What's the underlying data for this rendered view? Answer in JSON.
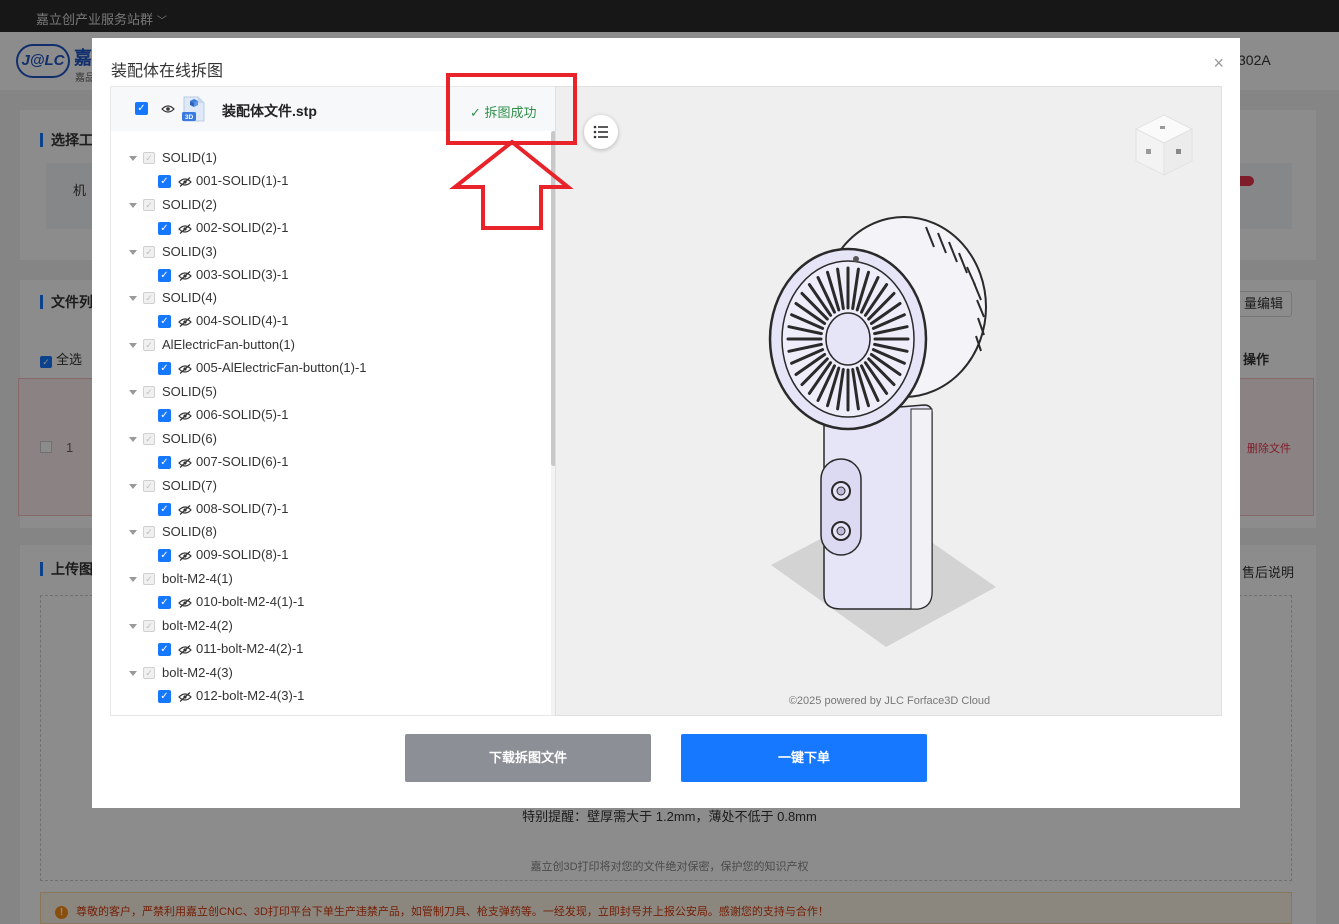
{
  "topbar": {
    "site_group": "嘉立创产业服务站群"
  },
  "header": {
    "logo": "J@LC",
    "logo_text": "嘉",
    "logo_sub": "嘉品",
    "user_code": "302A"
  },
  "background": {
    "section_process": "选择工",
    "option_label": "机",
    "section_files": "文件列",
    "batch_edit": "量编辑",
    "select_all": "全选",
    "operation_header": "操作",
    "row_number": "1",
    "delete_file": "删除文件",
    "section_upload": "上传图",
    "after_sale": "售后说明",
    "upload_tip": "特别提醒：壁厚需大于 1.2mm，薄处不低于 0.8mm",
    "privacy": "嘉立创3D打印将对您的文件绝对保密，保护您的知识产权",
    "warning": "尊敬的客户，严禁利用嘉立创CNC、3D打印平台下单生产违禁产品，如管制刀具、枪支弹药等。一经发现，立即封号并上报公安局。感谢您的支持与合作！"
  },
  "modal": {
    "title": "装配体在线拆图",
    "close": "×",
    "file": {
      "name": "装配体文件.stp",
      "icon_label": "3D",
      "status": "拆图成功"
    },
    "tree": [
      {
        "group": "SOLID(1)",
        "part": "001-SOLID(1)-1"
      },
      {
        "group": "SOLID(2)",
        "part": "002-SOLID(2)-1"
      },
      {
        "group": "SOLID(3)",
        "part": "003-SOLID(3)-1"
      },
      {
        "group": "SOLID(4)",
        "part": "004-SOLID(4)-1"
      },
      {
        "group": "AlElectricFan-button(1)",
        "part": "005-AlElectricFan-button(1)-1"
      },
      {
        "group": "SOLID(5)",
        "part": "006-SOLID(5)-1"
      },
      {
        "group": "SOLID(6)",
        "part": "007-SOLID(6)-1"
      },
      {
        "group": "SOLID(7)",
        "part": "008-SOLID(7)-1"
      },
      {
        "group": "SOLID(8)",
        "part": "009-SOLID(8)-1"
      },
      {
        "group": "bolt-M2-4(1)",
        "part": "010-bolt-M2-4(1)-1"
      },
      {
        "group": "bolt-M2-4(2)",
        "part": "011-bolt-M2-4(2)-1"
      },
      {
        "group": "bolt-M2-4(3)",
        "part": "012-bolt-M2-4(3)-1"
      }
    ],
    "viewer": {
      "powered_by": "©2025 powered by JLC Forface3D Cloud"
    },
    "buttons": {
      "download": "下载拆图文件",
      "order": "一键下单"
    }
  },
  "colors": {
    "primary": "#1677ff",
    "success": "#2f8f4a",
    "annotation": "#e8232a",
    "model_fill": "#e4e2f7"
  }
}
